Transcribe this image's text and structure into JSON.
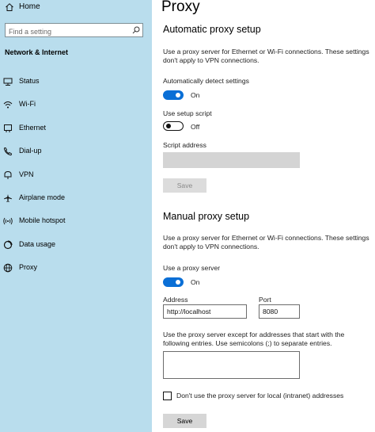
{
  "sidebar": {
    "home_label": "Home",
    "search_placeholder": "Find a setting",
    "section_title": "Network & Internet",
    "items": [
      {
        "label": "Status",
        "icon": "status-icon"
      },
      {
        "label": "Wi-Fi",
        "icon": "wifi-icon"
      },
      {
        "label": "Ethernet",
        "icon": "ethernet-icon"
      },
      {
        "label": "Dial-up",
        "icon": "dial-up-icon"
      },
      {
        "label": "VPN",
        "icon": "vpn-icon"
      },
      {
        "label": "Airplane mode",
        "icon": "airplane-icon"
      },
      {
        "label": "Mobile hotspot",
        "icon": "hotspot-icon"
      },
      {
        "label": "Data usage",
        "icon": "data-usage-icon"
      },
      {
        "label": "Proxy",
        "icon": "globe-icon"
      }
    ]
  },
  "main": {
    "title": "Proxy",
    "automatic": {
      "heading": "Automatic proxy setup",
      "description": "Use a proxy server for Ethernet or Wi-Fi connections. These settings don't apply to VPN connections.",
      "auto_detect_label": "Automatically detect settings",
      "auto_detect_state": "On",
      "setup_script_label": "Use setup script",
      "setup_script_state": "Off",
      "script_address_label": "Script address",
      "save_label": "Save"
    },
    "manual": {
      "heading": "Manual proxy setup",
      "description": "Use a proxy server for Ethernet or Wi-Fi connections. These settings don't apply to VPN connections.",
      "use_proxy_label": "Use a proxy server",
      "use_proxy_state": "On",
      "address_label": "Address",
      "address_value": "http://localhost",
      "port_label": "Port",
      "port_value": "8080",
      "exceptions_description": "Use the proxy server except for addresses that start with the following entries. Use semicolons (;) to separate entries.",
      "exceptions_value": "",
      "local_bypass_label": "Don't use the proxy server for local (intranet) addresses",
      "local_bypass_checked": false,
      "save_label": "Save"
    }
  },
  "colors": {
    "sidebar_bg": "#b9dded",
    "toggle_on": "#0a6fd6",
    "button_bg": "#d6d6d6"
  }
}
